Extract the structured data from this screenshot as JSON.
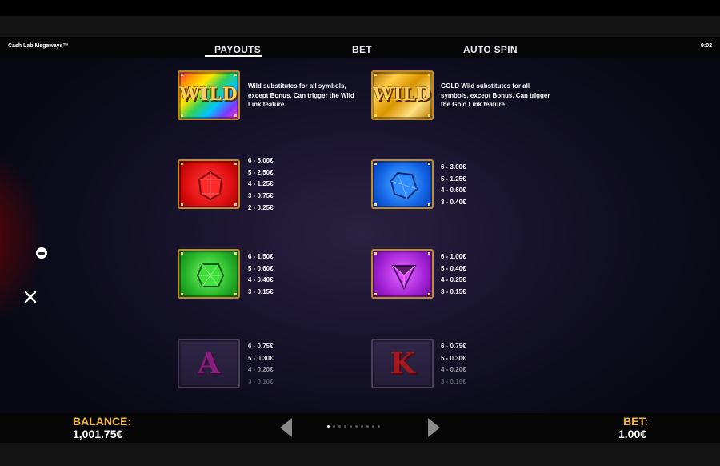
{
  "app": {
    "title": "Cash Lab Megaways™",
    "clock": "9:02"
  },
  "tabs": [
    {
      "label": "PAYOUTS",
      "active": true
    },
    {
      "label": "BET",
      "active": false
    },
    {
      "label": "AUTO SPIN",
      "active": false
    }
  ],
  "symbols": {
    "wild": {
      "label": "WILD",
      "description": "Wild substitutes for all symbols, except Bonus. Can trigger the Wild Link feature."
    },
    "gold_wild": {
      "label": "WILD",
      "description": "GOLD Wild substitutes for all symbols, except Bonus. Can trigger the Gold Link feature."
    },
    "red_gem": {
      "payouts": [
        "6 - 5.00€",
        "5 - 2.50€",
        "4 - 1.25€",
        "3 - 0.75€",
        "2 - 0.25€"
      ]
    },
    "blue_gem": {
      "payouts": [
        "6 - 3.00€",
        "5 - 1.25€",
        "4 - 0.60€",
        "3 - 0.40€"
      ]
    },
    "green_gem": {
      "payouts": [
        "6 - 1.50€",
        "5 - 0.60€",
        "4 - 0.40€",
        "3 - 0.15€"
      ]
    },
    "purple_gem": {
      "payouts": [
        "6 - 1.00€",
        "5 - 0.40€",
        "4 - 0.25€",
        "3 - 0.15€"
      ]
    },
    "card_a": {
      "label": "A",
      "payouts": [
        "6 - 0.75€",
        "5 - 0.30€",
        "4 - 0.20€",
        "3 - 0.10€"
      ]
    },
    "card_k": {
      "label": "K",
      "payouts": [
        "6 - 0.75€",
        "5 - 0.30€",
        "4 - 0.20€",
        "3 - 0.10€"
      ]
    }
  },
  "footer": {
    "balance_label": "BALANCE:",
    "balance_value": "1,001.75€",
    "bet_label": "BET:",
    "bet_value": "1.00€",
    "page_dots": 10,
    "active_page": 1
  },
  "colors": {
    "accent_gold": "#f2b830",
    "background": "#0e0d1d"
  }
}
